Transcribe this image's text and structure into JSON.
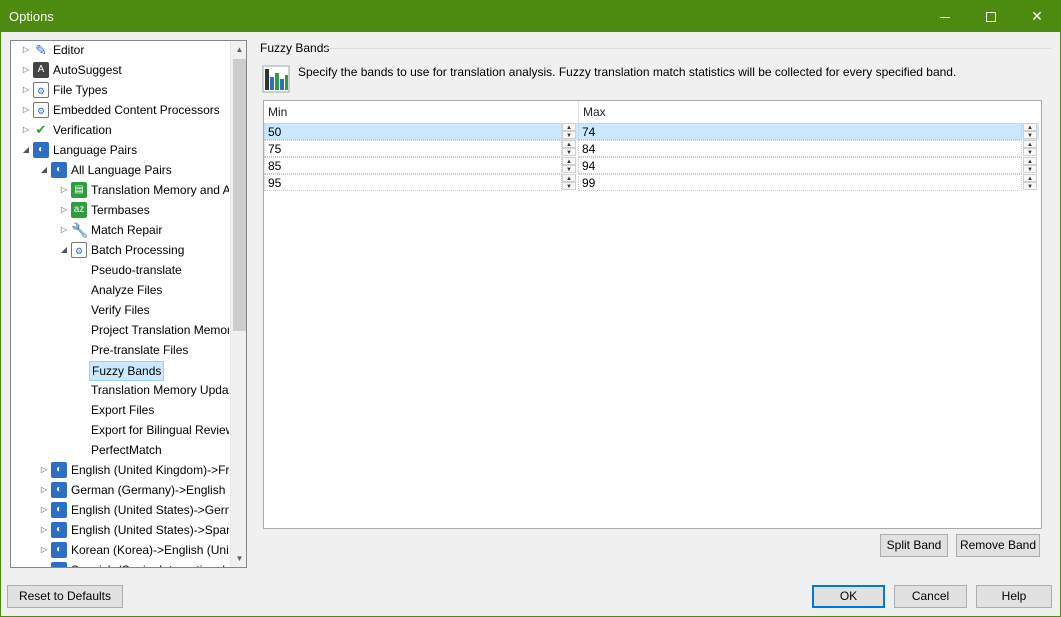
{
  "window": {
    "title": "Options",
    "controls": {
      "minimize": "minimize-icon",
      "maximize": "maximize-icon",
      "close": "close-icon"
    }
  },
  "tree": {
    "items": [
      {
        "label": "Editor",
        "icon": "pencil-icon",
        "level": 0,
        "expander": "collapsed"
      },
      {
        "label": "AutoSuggest",
        "icon": "autosuggest-icon",
        "level": 0,
        "expander": "collapsed"
      },
      {
        "label": "File Types",
        "icon": "file-types-icon",
        "level": 0,
        "expander": "collapsed"
      },
      {
        "label": "Embedded Content Processors",
        "icon": "embedded-content-icon",
        "level": 0,
        "expander": "collapsed"
      },
      {
        "label": "Verification",
        "icon": "verification-icon",
        "level": 0,
        "expander": "collapsed"
      },
      {
        "label": "Language Pairs",
        "icon": "language-pairs-icon",
        "level": 0,
        "expander": "expanded"
      },
      {
        "label": "All Language Pairs",
        "icon": "language-pair-icon",
        "level": 1,
        "expander": "expanded"
      },
      {
        "label": "Translation Memory and A",
        "icon": "translation-memory-icon",
        "level": 2,
        "expander": "collapsed"
      },
      {
        "label": "Termbases",
        "icon": "termbase-icon",
        "level": 2,
        "expander": "collapsed"
      },
      {
        "label": "Match Repair",
        "icon": "wrench-icon",
        "level": 2,
        "expander": "collapsed"
      },
      {
        "label": "Batch Processing",
        "icon": "batch-processing-icon",
        "level": 2,
        "expander": "expanded"
      },
      {
        "label": "Pseudo-translate",
        "level": 3
      },
      {
        "label": "Analyze Files",
        "level": 3
      },
      {
        "label": "Verify Files",
        "level": 3
      },
      {
        "label": "Project Translation Memori",
        "level": 3
      },
      {
        "label": "Pre-translate Files",
        "level": 3
      },
      {
        "label": "Fuzzy Bands",
        "level": 3,
        "selected": true
      },
      {
        "label": "Translation Memory Updat",
        "level": 3
      },
      {
        "label": "Export Files",
        "level": 3
      },
      {
        "label": "Export for Bilingual Review",
        "level": 3
      },
      {
        "label": "PerfectMatch",
        "level": 3
      },
      {
        "label": "English (United Kingdom)->Fre",
        "icon": "language-pair-icon",
        "level": 1,
        "expander": "collapsed"
      },
      {
        "label": "German (Germany)->English (",
        "icon": "language-pair-icon",
        "level": 1,
        "expander": "collapsed"
      },
      {
        "label": "English (United States)->Germ",
        "icon": "language-pair-icon",
        "level": 1,
        "expander": "collapsed"
      },
      {
        "label": "English (United States)->Spani",
        "icon": "language-pair-icon",
        "level": 1,
        "expander": "collapsed"
      },
      {
        "label": "Korean (Korea)->English (Unite",
        "icon": "language-pair-icon",
        "level": 1,
        "expander": "collapsed"
      },
      {
        "label": "Spanish (Spain, International S",
        "icon": "language-pair-icon",
        "level": 1,
        "expander": "collapsed"
      }
    ]
  },
  "panel": {
    "group_title": "Fuzzy Bands",
    "description": "Specify the bands to use for translation analysis. Fuzzy translation match statistics will be collected for every specified band.",
    "icon": "bar-chart-icon",
    "columns": {
      "min": "Min",
      "max": "Max"
    },
    "bands": [
      {
        "min": "50",
        "max": "74",
        "selected": true
      },
      {
        "min": "75",
        "max": "84"
      },
      {
        "min": "85",
        "max": "94"
      },
      {
        "min": "95",
        "max": "99"
      }
    ],
    "split_band": "Split Band",
    "remove_band": "Remove Band"
  },
  "footer": {
    "reset": "Reset to Defaults",
    "ok": "OK",
    "cancel": "Cancel",
    "help": "Help"
  },
  "colors": {
    "title_bar": "#4d8a10",
    "selection": "#cce8ff",
    "default_button_border": "#0078d7"
  }
}
